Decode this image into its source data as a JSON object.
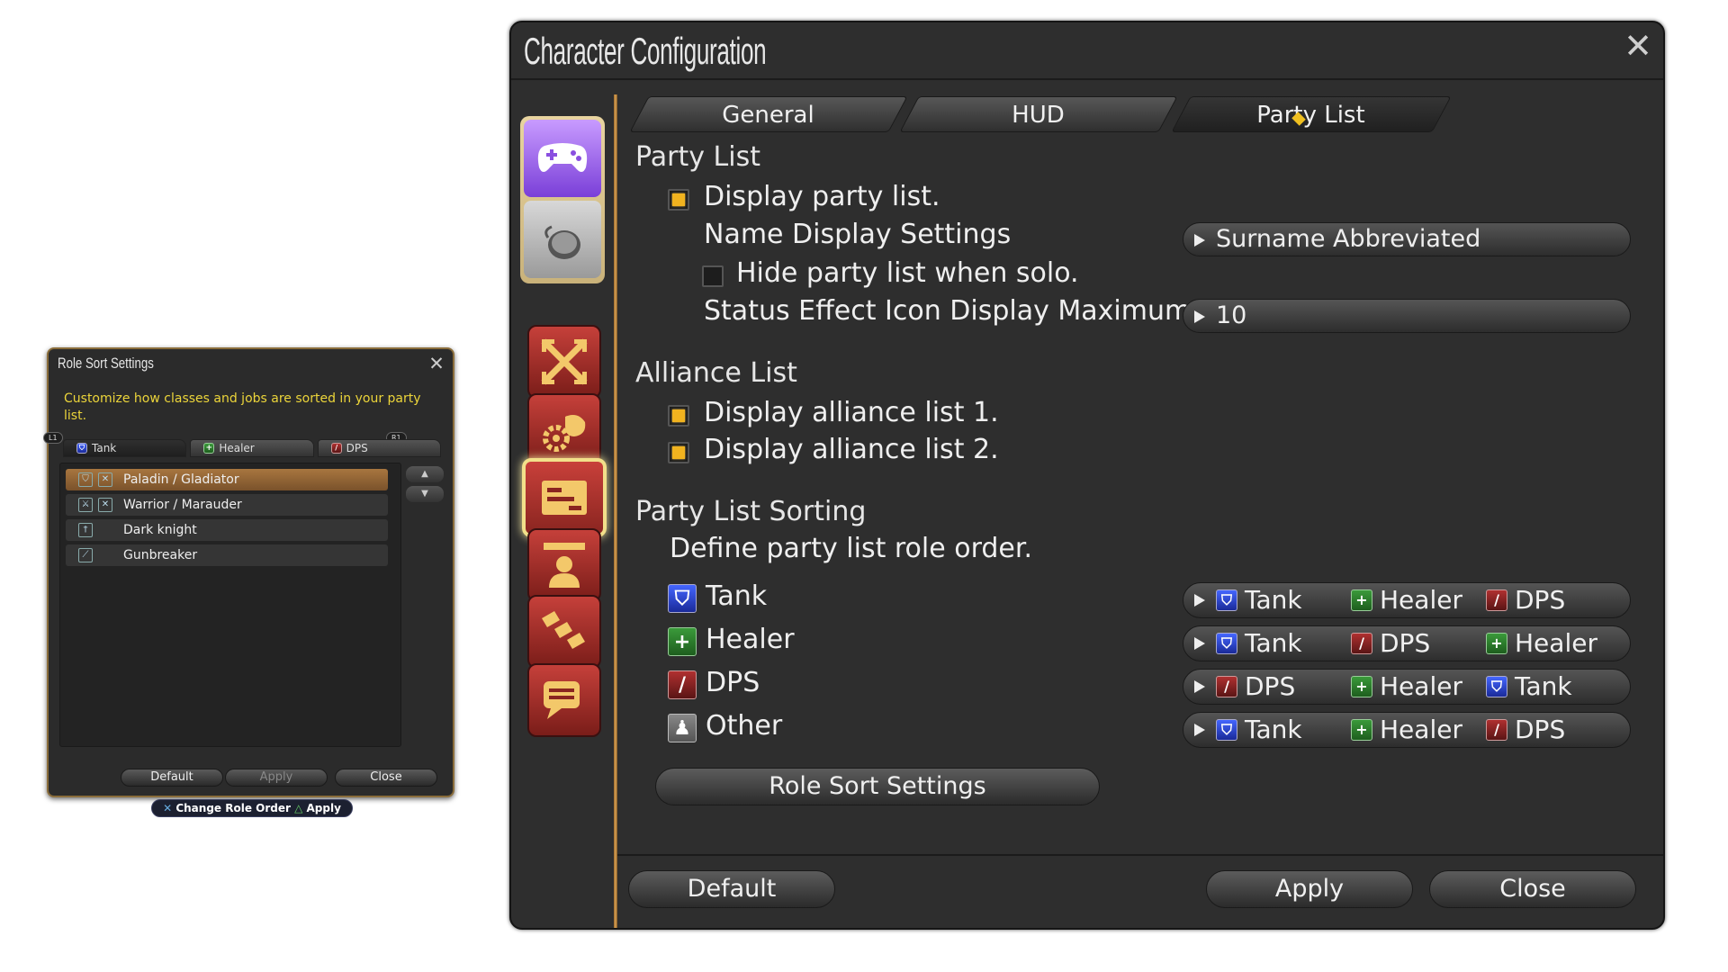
{
  "role_sort_window": {
    "title": "Role Sort Settings",
    "description": "Customize how classes and jobs are sorted in your party list.",
    "bumper_left": "L1",
    "bumper_right": "R1",
    "tabs": [
      "Tank",
      "Healer",
      "DPS"
    ],
    "jobs": [
      {
        "label": "Paladin / Gladiator",
        "selected": true
      },
      {
        "label": "Warrior / Marauder",
        "selected": false
      },
      {
        "label": "Dark knight",
        "selected": false
      },
      {
        "label": "Gunbreaker",
        "selected": false
      }
    ],
    "buttons": {
      "default": "Default",
      "apply": "Apply",
      "close": "Close"
    },
    "hint": {
      "change": "Change Role Order",
      "apply": "Apply"
    }
  },
  "config_window": {
    "title": "Character Configuration",
    "tabs": [
      "General",
      "HUD",
      "Party List"
    ],
    "active_tab": "Party List",
    "party_list": {
      "heading": "Party List",
      "display_party_list": {
        "label": "Display party list.",
        "checked": true
      },
      "name_display": {
        "label": "Name Display Settings",
        "value": "Surname Abbreviated"
      },
      "hide_solo": {
        "label": "Hide party list when solo.",
        "checked": false
      },
      "status_max": {
        "label": "Status Effect Icon Display Maximum",
        "value": "10"
      }
    },
    "alliance_list": {
      "heading": "Alliance List",
      "list1": {
        "label": "Display alliance list 1.",
        "checked": true
      },
      "list2": {
        "label": "Display alliance list 2.",
        "checked": true
      }
    },
    "sorting": {
      "heading": "Party List Sorting",
      "subtitle": "Define party list role order.",
      "roles": [
        {
          "label": "Tank",
          "icon": "tank",
          "order": [
            "Tank",
            "Healer",
            "DPS"
          ],
          "order_icons": [
            "tank",
            "heal",
            "dps"
          ]
        },
        {
          "label": "Healer",
          "icon": "heal",
          "order": [
            "Tank",
            "DPS",
            "Healer"
          ],
          "order_icons": [
            "tank",
            "dps",
            "heal"
          ]
        },
        {
          "label": "DPS",
          "icon": "dps",
          "order": [
            "DPS",
            "Healer",
            "Tank"
          ],
          "order_icons": [
            "dps",
            "heal",
            "tank"
          ]
        },
        {
          "label": "Other",
          "icon": "oth",
          "order": [
            "Tank",
            "Healer",
            "DPS"
          ],
          "order_icons": [
            "tank",
            "heal",
            "dps"
          ]
        }
      ],
      "role_sort_button": "Role Sort Settings"
    },
    "buttons": {
      "default": "Default",
      "apply": "Apply",
      "close": "Close"
    }
  },
  "colors": {
    "checkbox_on": "#f1b31f",
    "accent_gold": "#d9a255",
    "desc_yellow": "#ecd53a"
  }
}
